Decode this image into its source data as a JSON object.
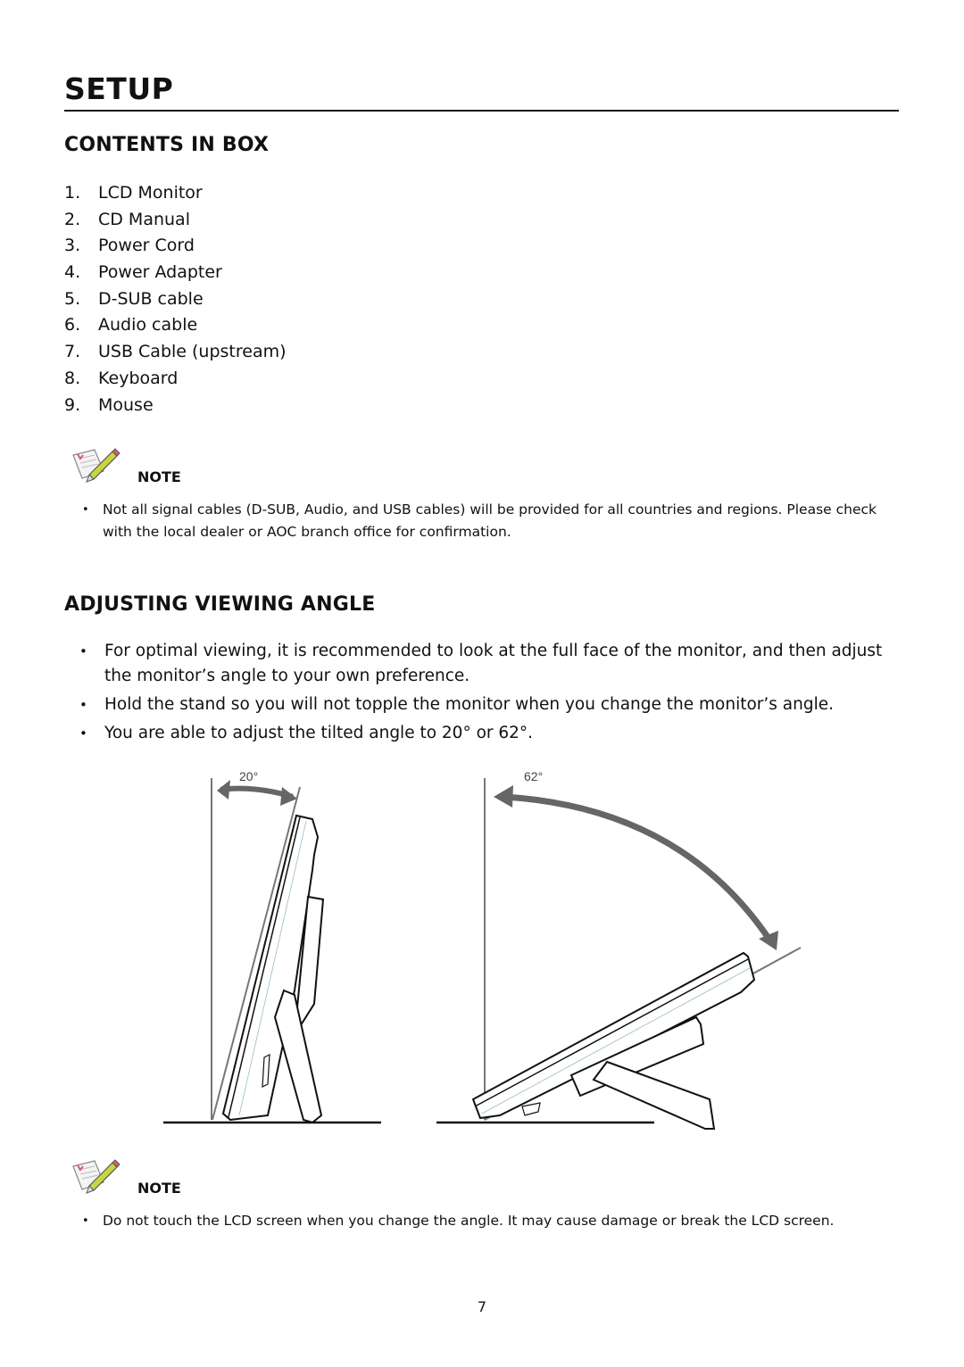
{
  "page": {
    "title": "SETUP",
    "page_number": "7"
  },
  "contents_section": {
    "heading": "CONTENTS IN BOX",
    "items": [
      {
        "num": "1.",
        "label": "LCD Monitor"
      },
      {
        "num": "2.",
        "label": "CD Manual"
      },
      {
        "num": "3.",
        "label": "Power Cord"
      },
      {
        "num": "4.",
        "label": "Power Adapter"
      },
      {
        "num": "5.",
        "label": "D-SUB cable"
      },
      {
        "num": "6.",
        "label": "Audio cable"
      },
      {
        "num": "7.",
        "label": "USB Cable (upstream)"
      },
      {
        "num": "8.",
        "label": "Keyboard"
      },
      {
        "num": "9.",
        "label": "Mouse"
      }
    ],
    "note": {
      "icon": "note-pencil-icon",
      "label": "NOTE",
      "bullets": [
        "Not all signal cables (D-SUB, Audio, and USB cables) will be provided for all countries and regions. Please check with the local dealer or AOC branch office for confirmation."
      ]
    }
  },
  "angle_section": {
    "heading": "ADJUSTING VIEWING ANGLE",
    "bullets": [
      "For optimal viewing, it is recommended to look at the full face of the monitor, and then adjust the monitor’s angle to your own preference.",
      "Hold the stand so you will not topple the monitor when you change the monitor’s angle.",
      "You are able to adjust the tilted angle to 20° or 62°."
    ],
    "figures": [
      {
        "name": "tilt-20",
        "label": "20°",
        "angle_deg": 20
      },
      {
        "name": "tilt-62",
        "label": "62°",
        "angle_deg": 62
      }
    ],
    "note": {
      "icon": "note-pencil-icon",
      "label": "NOTE",
      "bullets": [
        "Do not touch the LCD screen when you change the angle. It may cause damage or break the LCD screen."
      ]
    }
  },
  "colors": {
    "text": "#111111",
    "arrow": "#666666",
    "guide_line": "#777777",
    "note_pencil": "#c9d63a",
    "note_mark": "#e05a6a"
  }
}
